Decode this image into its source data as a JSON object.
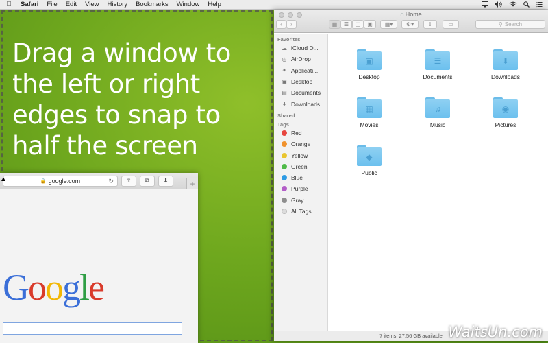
{
  "menubar": {
    "app": "Safari",
    "items": [
      "File",
      "Edit",
      "View",
      "History",
      "Bookmarks",
      "Window",
      "Help"
    ],
    "status_icons": [
      "display-icon",
      "volume-icon",
      "wifi-icon",
      "spotlight-icon",
      "notification-center-icon"
    ]
  },
  "desktop": {
    "snap_hint": "Drag a window to the left or right edges to snap to half the screen",
    "watermark": "WaitsUn.com"
  },
  "safari": {
    "address": "google.com",
    "google_logo": [
      {
        "ch": "G",
        "color": "#3b6fd8"
      },
      {
        "ch": "o",
        "color": "#d93b2b"
      },
      {
        "ch": "o",
        "color": "#f2b705"
      },
      {
        "ch": "g",
        "color": "#3b6fd8"
      },
      {
        "ch": "l",
        "color": "#2f9e44"
      },
      {
        "ch": "e",
        "color": "#d93b2b"
      }
    ]
  },
  "finder": {
    "title": "Home",
    "search_placeholder": "Search",
    "sidebar": {
      "favorites_header": "Favorites",
      "favorites": [
        {
          "label": "iCloud D...",
          "icon": "cloud-icon"
        },
        {
          "label": "AirDrop",
          "icon": "airdrop-icon"
        },
        {
          "label": "Applicati...",
          "icon": "applications-icon"
        },
        {
          "label": "Desktop",
          "icon": "desktop-icon"
        },
        {
          "label": "Documents",
          "icon": "documents-icon"
        },
        {
          "label": "Downloads",
          "icon": "downloads-icon"
        }
      ],
      "shared_header": "Shared",
      "tags_header": "Tags",
      "tags": [
        {
          "label": "Red",
          "color": "#e7463f"
        },
        {
          "label": "Orange",
          "color": "#f0922e"
        },
        {
          "label": "Yellow",
          "color": "#e9c52f"
        },
        {
          "label": "Green",
          "color": "#4fba48"
        },
        {
          "label": "Blue",
          "color": "#2e9be4"
        },
        {
          "label": "Purple",
          "color": "#b35ec8"
        },
        {
          "label": "Gray",
          "color": "#8e8e8e"
        },
        {
          "label": "All Tags...",
          "color": "#dcdcdc"
        }
      ]
    },
    "folders": [
      {
        "label": "Desktop",
        "icon": "desktop-icon"
      },
      {
        "label": "Documents",
        "icon": "documents-icon"
      },
      {
        "label": "Downloads",
        "icon": "downloads-icon"
      },
      {
        "label": "Movies",
        "icon": "movies-icon"
      },
      {
        "label": "Music",
        "icon": "music-icon"
      },
      {
        "label": "Pictures",
        "icon": "pictures-icon"
      },
      {
        "label": "Public",
        "icon": "public-icon"
      }
    ],
    "status": "7 items, 27.56 GB available"
  }
}
